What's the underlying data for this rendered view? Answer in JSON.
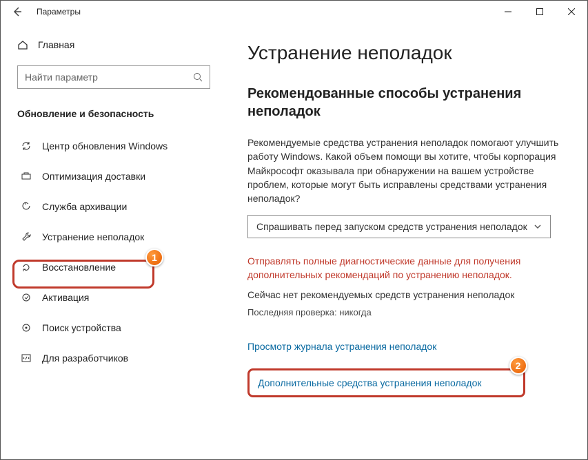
{
  "titlebar": {
    "title": "Параметры"
  },
  "sidebar": {
    "home": "Главная",
    "search_placeholder": "Найти параметр",
    "category": "Обновление и безопасность",
    "items": [
      "Центр обновления Windows",
      "Оптимизация доставки",
      "Служба архивации",
      "Устранение неполадок",
      "Восстановление",
      "Активация",
      "Поиск устройства",
      "Для разработчиков"
    ]
  },
  "main": {
    "title": "Устранение неполадок",
    "subtitle": "Рекомендованные способы устранения неполадок",
    "description": "Рекомендуемые средства устранения неполадок помогают улучшить работу Windows. Какой объем помощи вы хотите, чтобы корпорация Майкрософт оказывала при обнаружении на вашем устройстве проблем, которые могут быть исправлены средствами устранения неполадок?",
    "dropdown_value": "Спрашивать перед запуском средств устранения неполадок",
    "warning": "Отправлять полные диагностические данные для получения дополнительных рекомендаций по устранению неполадок.",
    "no_recommended": "Сейчас нет рекомендуемых средств устранения неполадок",
    "last_check": "Последняя проверка: никогда",
    "history_link": "Просмотр журнала устранения неполадок",
    "additional_link": "Дополнительные средства устранения неполадок"
  },
  "annotations": {
    "m1": "1",
    "m2": "2"
  }
}
